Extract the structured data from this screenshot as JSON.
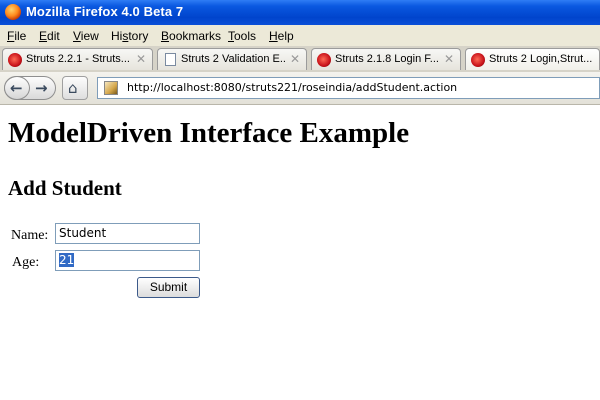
{
  "window": {
    "title": "Mozilla Firefox 4.0 Beta 7"
  },
  "menu": [
    {
      "label": "File",
      "key": "F"
    },
    {
      "label": "Edit",
      "key": "E"
    },
    {
      "label": "View",
      "key": "V"
    },
    {
      "label": "History",
      "key": "s"
    },
    {
      "label": "Bookmarks",
      "key": "B"
    },
    {
      "label": "Tools",
      "key": "T"
    },
    {
      "label": "Help",
      "key": "H"
    }
  ],
  "tabs": [
    {
      "label": "Struts 2.2.1 - Struts...",
      "icon": "struts-icon",
      "active": false
    },
    {
      "label": "Struts 2 Validation E...",
      "icon": "page-icon",
      "active": false
    },
    {
      "label": "Struts 2.1.8 Login F...",
      "icon": "struts-icon",
      "active": false
    },
    {
      "label": "Struts 2 Login,Strut...",
      "icon": "struts-icon",
      "active": true
    }
  ],
  "nav": {
    "back_icon": "back-arrow-icon",
    "forward_icon": "forward-arrow-icon",
    "home_icon": "home-icon",
    "url": "http://localhost:8080/struts221/roseindia/addStudent.action"
  },
  "page": {
    "title": "ModelDriven Interface Example",
    "subtitle": "Add Student",
    "form": {
      "name_label": "Name:",
      "name_value": "Student",
      "age_label": "Age:",
      "age_value": "21",
      "submit_label": "Submit"
    }
  },
  "colors": {
    "titlebar": "#0a58e0",
    "selection": "#316ac5",
    "chrome": "#ece9d8"
  }
}
